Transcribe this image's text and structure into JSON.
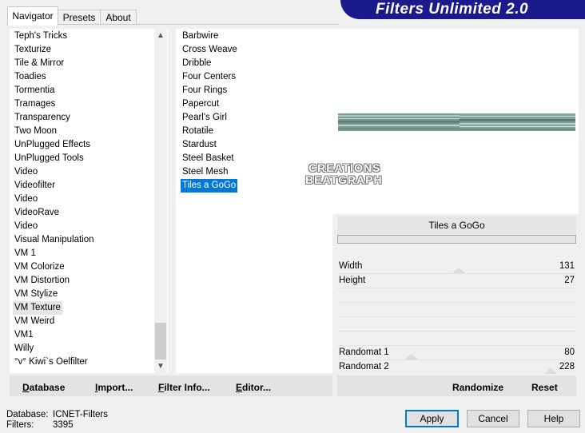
{
  "app": {
    "title": "Filters Unlimited 2.0"
  },
  "tabs": [
    {
      "label": "Navigator",
      "active": true
    },
    {
      "label": "Presets",
      "active": false
    },
    {
      "label": "About",
      "active": false
    }
  ],
  "categories": [
    "Teph's Tricks",
    "Texturize",
    "Tile & Mirror",
    "Toadies",
    "Tormentia",
    "Tramages",
    "Transparency",
    "Two Moon",
    "UnPlugged Effects",
    "UnPlugged Tools",
    "Video",
    "Videofilter",
    "Video",
    "VideoRave",
    "Video",
    "Visual Manipulation",
    "VM 1",
    "VM Colorize",
    "VM Distortion",
    "VM Stylize",
    "VM Texture",
    "VM Weird",
    "VM1",
    "Willy",
    "°v° Kiwi`s Oelfilter"
  ],
  "selected_category_index": 20,
  "filters": [
    "Barbwire",
    "Cross Weave",
    "Dribble",
    "Four Centers",
    "Four Rings",
    "Papercut",
    "Pearl's Girl",
    "Rotatile",
    "Stardust",
    "Steel Basket",
    "Steel Mesh",
    "Tiles a GoGo"
  ],
  "selected_filter_index": 11,
  "watermark": {
    "line1": "CREATIONS",
    "line2": "BEATGRAPH"
  },
  "params": {
    "filter_title": "Tiles a GoGo",
    "width_label": "Width",
    "width_value": "131",
    "height_label": "Height",
    "height_value": "27",
    "randomat1_label": "Randomat 1",
    "randomat1_value": "80",
    "randomat2_label": "Randomat 2",
    "randomat2_value": "228"
  },
  "toolbar": {
    "database": {
      "first": "D",
      "rest": "atabase"
    },
    "import": {
      "first": "I",
      "rest": "mport..."
    },
    "filter_info": {
      "first": "F",
      "rest": "ilter Info..."
    },
    "editor": {
      "first": "E",
      "rest": "ditor..."
    },
    "randomize": "Randomize",
    "reset": "Reset"
  },
  "status": {
    "database_label": "Database:",
    "database_value": "ICNET-Filters",
    "filters_label": "Filters:",
    "filters_value": "3395"
  },
  "buttons": {
    "apply": "Apply",
    "cancel": "Cancel",
    "help": "Help"
  },
  "colors": {
    "banner": "#1a1a8c",
    "selection": "#0078d7"
  }
}
